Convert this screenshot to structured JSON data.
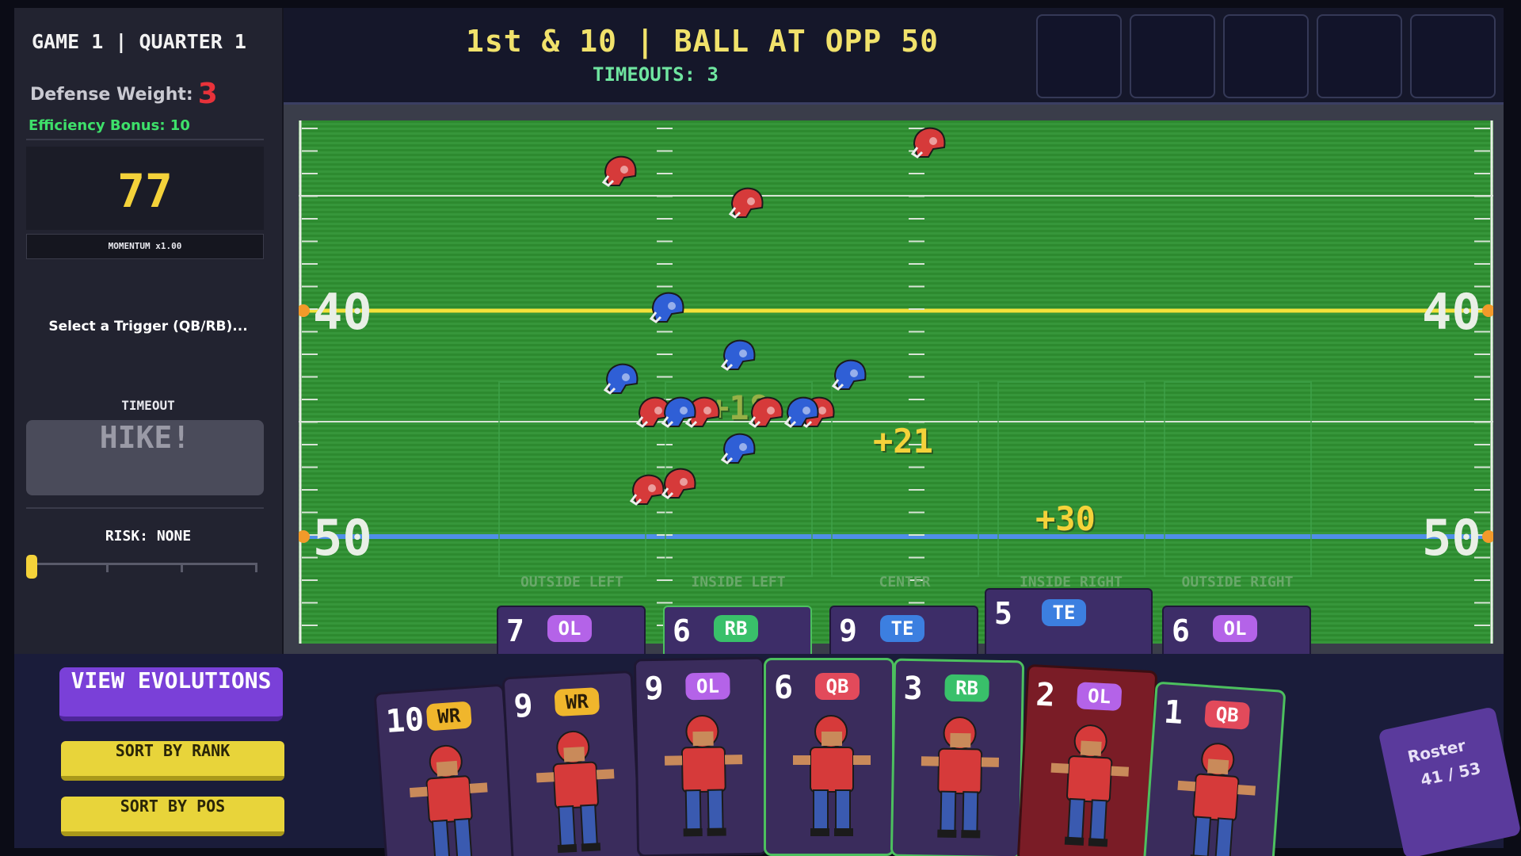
{
  "hud": {
    "game_quarter": "GAME 1 | QUARTER 1",
    "defense_weight_label": "Defense Weight:",
    "defense_weight_value": "3",
    "efficiency_bonus": "Efficiency Bonus: 10",
    "score": "77",
    "momentum": "MOMENTUM x1.00",
    "trigger_prompt": "Select a Trigger (QB/RB)...",
    "timeout_label": "TIMEOUT",
    "hike_label": "HIKE!",
    "risk": "RISK: NONE"
  },
  "top": {
    "down_distance": "1st & 10 | BALL AT OPP 50",
    "timeouts": "TIMEOUTS: 3",
    "slot_count": 5
  },
  "field": {
    "yard_numbers": {
      "upper": "40",
      "lower": "50"
    },
    "zones": [
      "OUTSIDE LEFT",
      "INSIDE LEFT",
      "CENTER",
      "INSIDE RIGHT",
      "OUTSIDE RIGHT"
    ],
    "bonuses": {
      "inside_left": "+18",
      "center": "+21",
      "inside_right": "+30"
    },
    "colors": {
      "line_of_scrimmage": "#f3e23a",
      "first_down": "#4f8ee8",
      "offense": "#2f5fd6",
      "defense": "#d63a3a"
    }
  },
  "zone_slots": [
    {
      "number": "7",
      "position": "OL"
    },
    {
      "number": "6",
      "position": "RB"
    },
    {
      "number": "9",
      "position": "TE"
    },
    {
      "number": "5",
      "position": "TE"
    },
    {
      "number": "6",
      "position": "OL"
    }
  ],
  "buttons": {
    "view_evolutions": "VIEW EVOLUTIONS",
    "sort_rank": "SORT BY RANK",
    "sort_pos": "SORT BY POS"
  },
  "hand": [
    {
      "number": "10",
      "position": "WR"
    },
    {
      "number": "9",
      "position": "WR"
    },
    {
      "number": "9",
      "position": "OL"
    },
    {
      "number": "6",
      "position": "QB"
    },
    {
      "number": "3",
      "position": "RB"
    },
    {
      "number": "2",
      "position": "OL"
    },
    {
      "number": "1",
      "position": "QB"
    }
  ],
  "roster": {
    "label": "Roster",
    "count": "41 / 53"
  }
}
